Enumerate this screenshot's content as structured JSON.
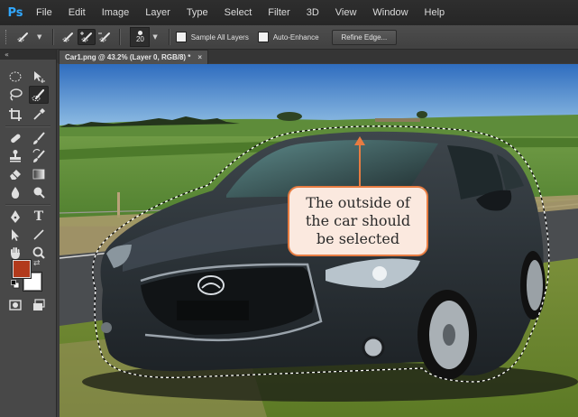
{
  "app": {
    "logo": "Ps",
    "accent": "#31a8ff"
  },
  "menu": [
    "File",
    "Edit",
    "Image",
    "Layer",
    "Type",
    "Select",
    "Filter",
    "3D",
    "View",
    "Window",
    "Help"
  ],
  "options": {
    "tool_icon": "quick-selection-icon",
    "modes": [
      "new-selection-icon",
      "add-to-selection-icon",
      "subtract-from-selection-icon"
    ],
    "brush_size": "20",
    "sample_all_layers": {
      "label": "Sample All Layers",
      "checked": false
    },
    "auto_enhance": {
      "label": "Auto-Enhance",
      "checked": false
    },
    "refine_edge": "Refine Edge..."
  },
  "toolbox": {
    "collapse": "«",
    "tools": [
      "elliptical-marquee-icon",
      "move-icon",
      "lasso-icon",
      "quick-selection-icon",
      "crop-icon",
      "eyedropper-icon",
      "spot-healing-icon",
      "brush-icon",
      "clone-stamp-icon",
      "history-brush-icon",
      "eraser-icon",
      "gradient-icon",
      "blur-icon",
      "dodge-icon",
      "pen-icon",
      "type-icon",
      "path-selection-icon",
      "line-icon",
      "hand-icon",
      "zoom-icon"
    ],
    "type_tool_glyph": "T",
    "foreground_color": "#b23a1c",
    "background_color": "#ffffff"
  },
  "document": {
    "tab_title": "Car1.png @ 43.2% (Layer 0, RGB/8) *",
    "close": "×"
  },
  "callout": {
    "lines": [
      "The outside of",
      "the car should",
      "be selected"
    ],
    "border": "#e77c42",
    "fill": "#fbe9df"
  }
}
